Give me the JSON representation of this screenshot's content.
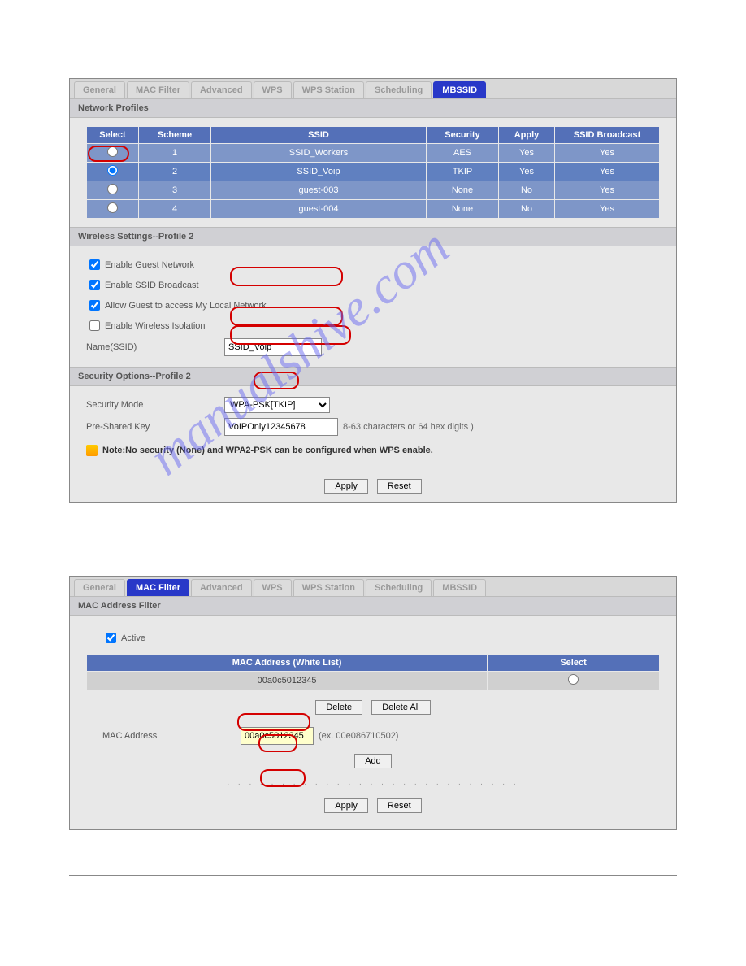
{
  "panel1": {
    "tabs": [
      "General",
      "MAC Filter",
      "Advanced",
      "WPS",
      "WPS Station",
      "Scheduling",
      "MBSSID"
    ],
    "active_tab": 6,
    "section1_title": "Network Profiles",
    "np_headers": [
      "Select",
      "Scheme",
      "SSID",
      "Security",
      "Apply",
      "SSID Broadcast"
    ],
    "np_rows": [
      {
        "scheme": "1",
        "ssid": "SSID_Workers",
        "security": "AES",
        "apply": "Yes",
        "broadcast": "Yes",
        "selected": false
      },
      {
        "scheme": "2",
        "ssid": "SSID_Voip",
        "security": "TKIP",
        "apply": "Yes",
        "broadcast": "Yes",
        "selected": true
      },
      {
        "scheme": "3",
        "ssid": "guest-003",
        "security": "None",
        "apply": "No",
        "broadcast": "Yes",
        "selected": false
      },
      {
        "scheme": "4",
        "ssid": "guest-004",
        "security": "None",
        "apply": "No",
        "broadcast": "Yes",
        "selected": false
      }
    ],
    "section2_title": "Wireless Settings--Profile 2",
    "cb_guest": "Enable Guest Network",
    "cb_broadcast": "Enable SSID Broadcast",
    "cb_allow": "Allow Guest to access My Local Network",
    "cb_isolation": "Enable Wireless Isolation",
    "name_label": "Name(SSID)",
    "name_value": "SSID_Voip",
    "section3_title": "Security Options--Profile 2",
    "secmode_label": "Security Mode",
    "secmode_value": "WPA-PSK[TKIP]",
    "psk_label": "Pre-Shared Key",
    "psk_value": "VoIPOnly12345678",
    "psk_hint": "8-63 characters or 64 hex digits )",
    "note_text": "Note:No security (None) and WPA2-PSK can be configured when WPS enable.",
    "apply_btn": "Apply",
    "reset_btn": "Reset"
  },
  "panel2": {
    "tabs": [
      "General",
      "MAC Filter",
      "Advanced",
      "WPS",
      "WPS Station",
      "Scheduling",
      "MBSSID"
    ],
    "active_tab": 1,
    "section1_title": "MAC Address Filter",
    "active_label": "Active",
    "mac_headers": [
      "MAC Address (White List)",
      "Select"
    ],
    "mac_rows": [
      {
        "mac": "00a0c5012345"
      }
    ],
    "delete_btn": "Delete",
    "deleteall_btn": "Delete All",
    "macaddr_label": "MAC Address",
    "macaddr_value": "00a0c5012345",
    "macaddr_hint": "(ex. 00e086710502)",
    "add_btn": "Add",
    "apply_btn": "Apply",
    "reset_btn": "Reset"
  },
  "watermark": "manualshive.com"
}
